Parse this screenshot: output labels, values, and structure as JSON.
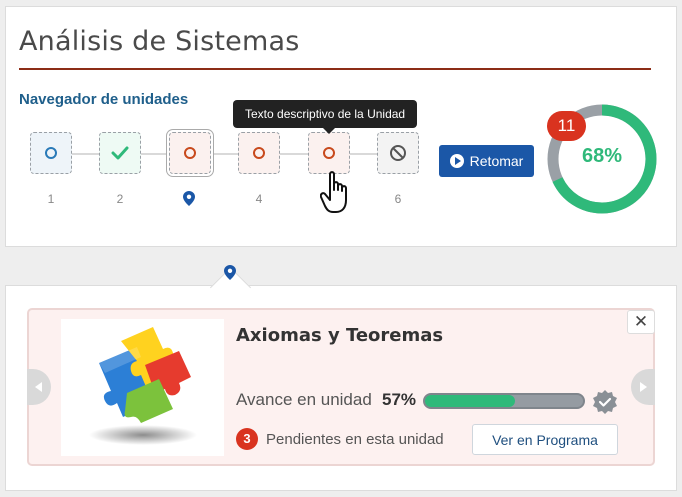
{
  "page": {
    "title": "Análisis de Sistemas"
  },
  "navigator": {
    "heading": "Navegador de unidades",
    "units": [
      {
        "number": "1",
        "status": "pending",
        "icon": "ring-icon"
      },
      {
        "number": "2",
        "status": "completed",
        "icon": "check-icon"
      },
      {
        "number": "",
        "status": "current",
        "icon": "ring-icon"
      },
      {
        "number": "4",
        "status": "pending",
        "icon": "ring-icon"
      },
      {
        "number": "",
        "status": "hovered",
        "icon": "ring-icon"
      },
      {
        "number": "6",
        "status": "blocked",
        "icon": "ban-icon"
      }
    ],
    "tooltip": "Texto descriptivo de la Unidad",
    "retomar_label": "Retomar"
  },
  "overall": {
    "percent_label": "68%",
    "progress": 0.68,
    "pending_count": "11"
  },
  "unit_detail": {
    "title": "Axiomas y Teoremas",
    "avance_label": "Avance en unidad",
    "avance_pct_label": "57%",
    "avance_value": 0.57,
    "pending_count": "3",
    "pending_text": "Pendientes en esta unidad",
    "programa_label": "Ver en Programa"
  },
  "colors": {
    "accent_blue": "#1b57a7",
    "title_rule": "#8c2d17",
    "heading_blue": "#1f5f8b",
    "success_green": "#2fb97a",
    "alert_red": "#d9331f"
  }
}
